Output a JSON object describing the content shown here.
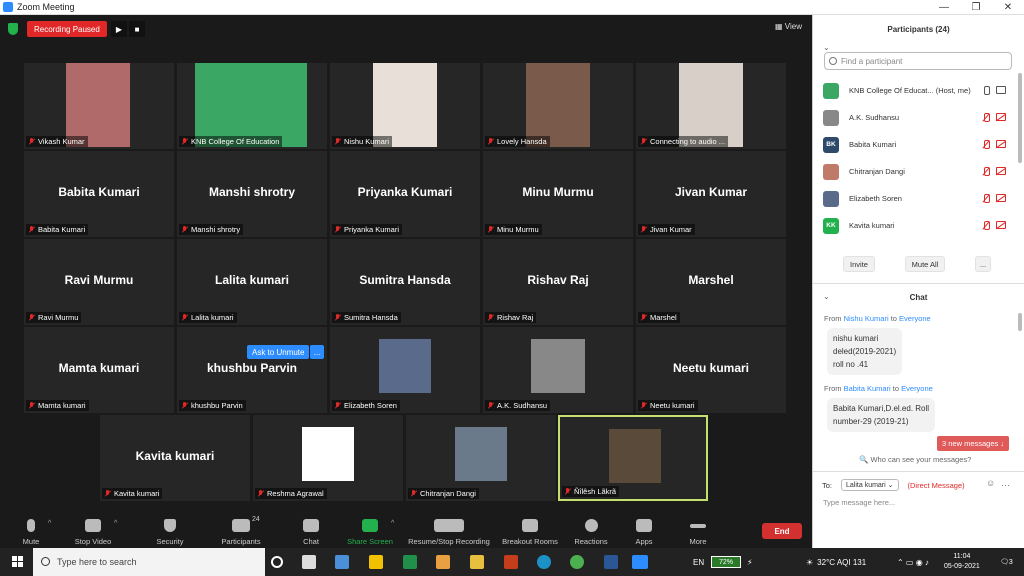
{
  "window": {
    "title": "Zoom Meeting",
    "buttons": [
      "—",
      "❐",
      "✕"
    ]
  },
  "topbar": {
    "recording_status": "Recording Paused",
    "view_label": "View"
  },
  "tiles": [
    {
      "name": "Vikash Kumar",
      "video": true,
      "photo_color": "#b06a6a"
    },
    {
      "name": "KNB College Of Education",
      "video": true,
      "photo_color": "#3aa864"
    },
    {
      "name": "Nishu Kumari",
      "video": true,
      "photo_color": "#e8e0d8"
    },
    {
      "name": "Lovely Hansda",
      "video": true,
      "photo_color": "#7a5a4a"
    },
    {
      "name": "Connecting to audio ...",
      "video": true,
      "photo_color": "#d8d0c8"
    },
    {
      "name": "Babita Kumari",
      "video": false
    },
    {
      "name": "Manshi shrotry",
      "video": false
    },
    {
      "name": "Priyanka Kumari",
      "video": false
    },
    {
      "name": "Minu Murmu",
      "video": false
    },
    {
      "name": "Jivan Kumar",
      "video": false
    },
    {
      "name": "Ravi Murmu",
      "video": false
    },
    {
      "name": "Lalita kumari",
      "video": false
    },
    {
      "name": "Sumitra Hansda",
      "video": false
    },
    {
      "name": "Rishav Raj",
      "video": false
    },
    {
      "name": "Marshel",
      "video": false
    },
    {
      "name": "Mamta kumari",
      "video": false
    },
    {
      "name": "khushbu Parvin",
      "video": false
    },
    {
      "name": "Elizabeth Soren",
      "video": true,
      "photo_color": "#5a6a8a"
    },
    {
      "name": "A.K. Sudhansu",
      "video": true,
      "photo_color": "#888888"
    },
    {
      "name": "Neetu kumari",
      "video": false
    },
    {
      "name": "Kavita kumari",
      "video": false
    },
    {
      "name": "Reshma Agrawal",
      "video": true,
      "photo_color": "#ffffff"
    },
    {
      "name": "Chitranjan Dangi",
      "video": true,
      "photo_color": "#6a7a8a"
    },
    {
      "name": "Ñîlêsh Lãkrã",
      "video": true,
      "photo_color": "#5a4a3a"
    }
  ],
  "ask_to_unmute": "Ask to Unmute",
  "ask_to_unmute_more": "...",
  "toolbar": {
    "mute": "Mute",
    "stop_video": "Stop Video",
    "security": "Security",
    "participants": "Participants",
    "participants_count": "24",
    "chat": "Chat",
    "share_screen": "Share Screen",
    "resume_stop_recording": "Resume/Stop Recording",
    "breakout_rooms": "Breakout Rooms",
    "reactions": "Reactions",
    "apps": "Apps",
    "more": "More",
    "end": "End"
  },
  "participants_panel": {
    "title": "Participants (24)",
    "search_placeholder": "Find a participant",
    "items": [
      {
        "name": "KNB College Of Educat... (Host, me)",
        "initials": "",
        "color": "#3aa864",
        "muted": false
      },
      {
        "name": "A.K. Sudhansu",
        "initials": "",
        "color": "#888888",
        "muted": true
      },
      {
        "name": "Babita Kumari",
        "initials": "BK",
        "color": "#2d4a6a",
        "muted": true
      },
      {
        "name": "Chitranjan Dangi",
        "initials": "",
        "color": "#c07a6a",
        "muted": true
      },
      {
        "name": "Elizabeth Soren",
        "initials": "",
        "color": "#5a6a8a",
        "muted": true
      },
      {
        "name": "Kavita kumari",
        "initials": "KK",
        "color": "#23b14d",
        "muted": true
      }
    ],
    "invite": "Invite",
    "mute_all": "Mute All",
    "more": "..."
  },
  "chat_panel": {
    "title": "Chat",
    "messages": [
      {
        "from": "Nishu Kumari",
        "to": "Everyone",
        "lines": [
          "nishu kumari",
          "deled(2019-2021)",
          "roll no .41"
        ]
      },
      {
        "from": "Babita Kumari",
        "to": "Everyone",
        "lines": [
          "Babita Kumari,D.el.ed. Roll",
          "number-29 (2019-21)"
        ]
      }
    ],
    "from_word": "From",
    "to_word": "to",
    "new_messages": "3 new messages ↓",
    "who_can_see": "Who can see your messages?",
    "to_label": "To:",
    "recipient": "Lalita kumari",
    "direct_message": "(Direct Message)",
    "input_placeholder": "Type message here..."
  },
  "taskbar": {
    "search_placeholder": "Type here to search",
    "lang": "EN",
    "battery": "72%",
    "weather": "32°C  AQI 131",
    "time": "11:04",
    "date": "05-09-2021",
    "notif_count": "3"
  }
}
